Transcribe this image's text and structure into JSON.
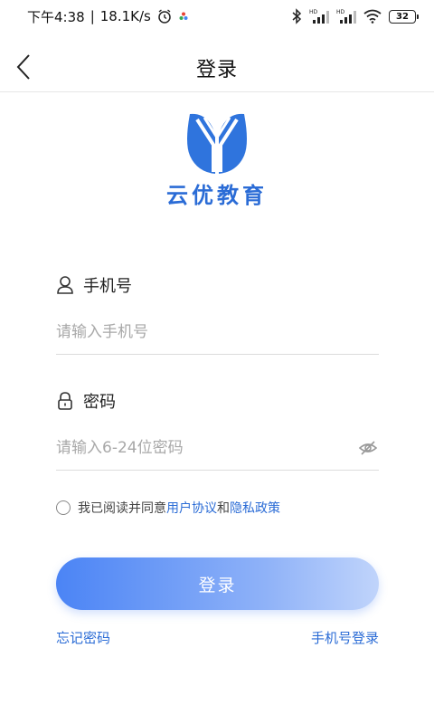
{
  "status_bar": {
    "time": "下午4:38",
    "speed": "18.1K/s",
    "battery": "32"
  },
  "nav": {
    "title": "登录"
  },
  "brand": {
    "name": "云优教育",
    "color": "#2b6cd6"
  },
  "form": {
    "phone_label": "手机号",
    "phone_placeholder": "请输入手机号",
    "password_label": "密码",
    "password_placeholder": "请输入6-24位密码",
    "agree_prefix": "我已阅读并同意",
    "agree_user": "用户协议",
    "agree_and": "和",
    "agree_privacy": "隐私政策",
    "login_label": "登录",
    "forgot_label": "忘记密码",
    "phone_login_label": "手机号登录"
  }
}
